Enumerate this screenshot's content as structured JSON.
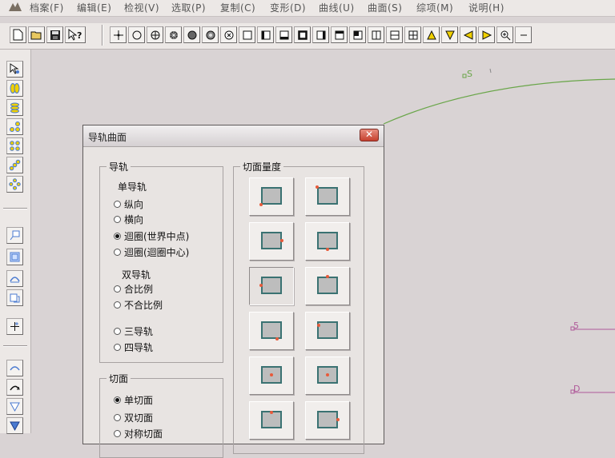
{
  "menubar": {
    "items": [
      "档案(F)",
      "编辑(E)",
      "检视(V)",
      "选取(P)",
      "复制(C)",
      "变形(D)",
      "曲线(U)",
      "曲面(S)",
      "综项(M)",
      "说明(H)"
    ]
  },
  "toolbar": {
    "buttons": [
      "new-file",
      "open-file",
      "save-file",
      "help",
      "point",
      "circle",
      "circle-plus",
      "circle-grid",
      "circle-filled",
      "circle-dotted",
      "circle-cross",
      "square",
      "square-left",
      "square-bottom",
      "square-thick",
      "square-right",
      "square-top",
      "square-corner",
      "split-vertical",
      "split-horizontal",
      "grid-four",
      "triangle-up",
      "triangle-down",
      "triangle-left",
      "triangle-right",
      "zoom-in",
      "more"
    ]
  },
  "canvas": {
    "labels": [
      "S",
      "5",
      "D"
    ],
    "curve_color": "#6aa64a",
    "line_color": "#b05a9a"
  },
  "dialog": {
    "title": "导轨曲面",
    "close_label": "✕",
    "rail_group": {
      "label": "导轨",
      "single_label": "单导轨",
      "single_options": [
        {
          "label": "纵向",
          "checked": false
        },
        {
          "label": "横向",
          "checked": false
        },
        {
          "label": "迴圈(世界中点)",
          "checked": true
        },
        {
          "label": "迴圈(迴圈中心)",
          "checked": false
        }
      ],
      "double_label": "双导轨",
      "double_options": [
        {
          "label": "合比例",
          "checked": false
        },
        {
          "label": "不合比例",
          "checked": false
        }
      ],
      "multi_options": [
        {
          "label": "三导轨",
          "checked": false
        },
        {
          "label": "四导轨",
          "checked": false
        }
      ]
    },
    "section_group": {
      "label": "切面",
      "options": [
        {
          "label": "单切面",
          "checked": true
        },
        {
          "label": "双切面",
          "checked": false
        },
        {
          "label": "对称切面",
          "checked": false
        }
      ]
    },
    "measure_group": {
      "label": "切面量度"
    }
  }
}
